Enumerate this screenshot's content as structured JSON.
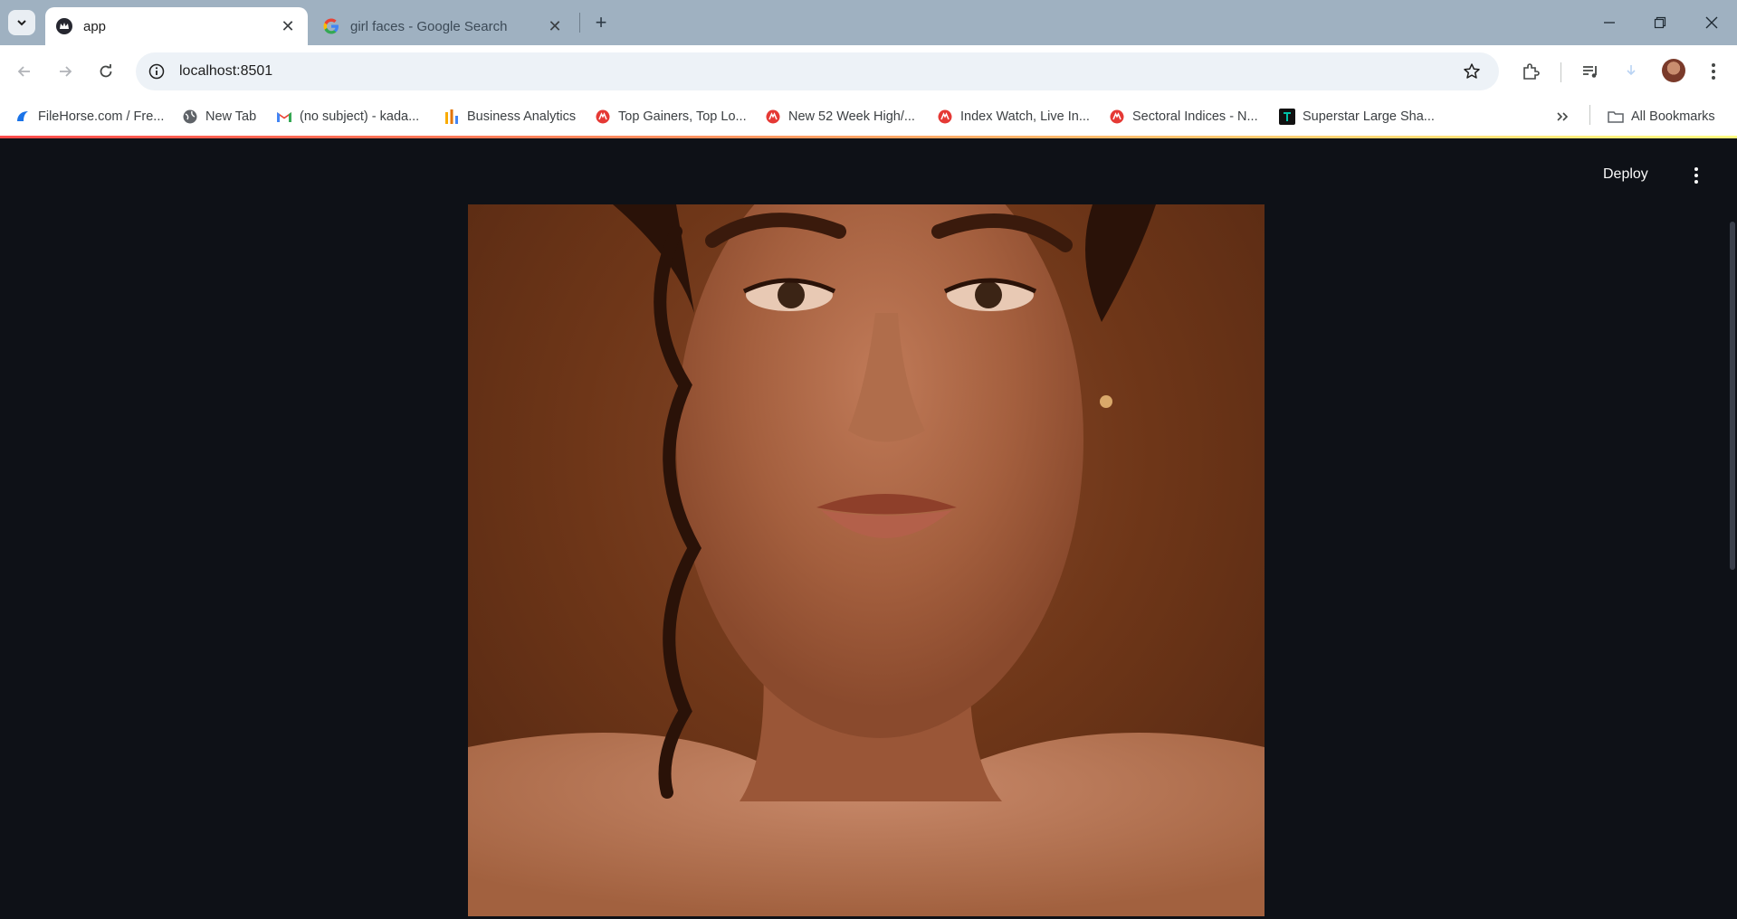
{
  "browser": {
    "tabs": [
      {
        "title": "app",
        "active": true
      },
      {
        "title": "girl faces - Google Search",
        "active": false
      }
    ],
    "url": "localhost:8501",
    "bookmarks": [
      {
        "label": "FileHorse.com / Fre...",
        "icon": "filehorse-icon"
      },
      {
        "label": "New Tab",
        "icon": "globe-icon"
      },
      {
        "label": "(no subject) - kada...",
        "icon": "gmail-icon"
      },
      {
        "label": "Business Analytics",
        "icon": "analytics-icon"
      },
      {
        "label": "Top Gainers, Top Lo...",
        "icon": "moneycontrol-icon"
      },
      {
        "label": "New 52 Week High/...",
        "icon": "moneycontrol-icon"
      },
      {
        "label": "Index Watch, Live In...",
        "icon": "moneycontrol-icon"
      },
      {
        "label": "Sectoral Indices - N...",
        "icon": "moneycontrol-icon"
      },
      {
        "label": "Superstar Large Sha...",
        "icon": "trendlyne-icon"
      }
    ],
    "all_bookmarks_label": "All Bookmarks"
  },
  "app": {
    "deploy_label": "Deploy",
    "accent_gradient": [
      "#ff4b4b",
      "#fffd80"
    ],
    "background": "#0e1117"
  }
}
